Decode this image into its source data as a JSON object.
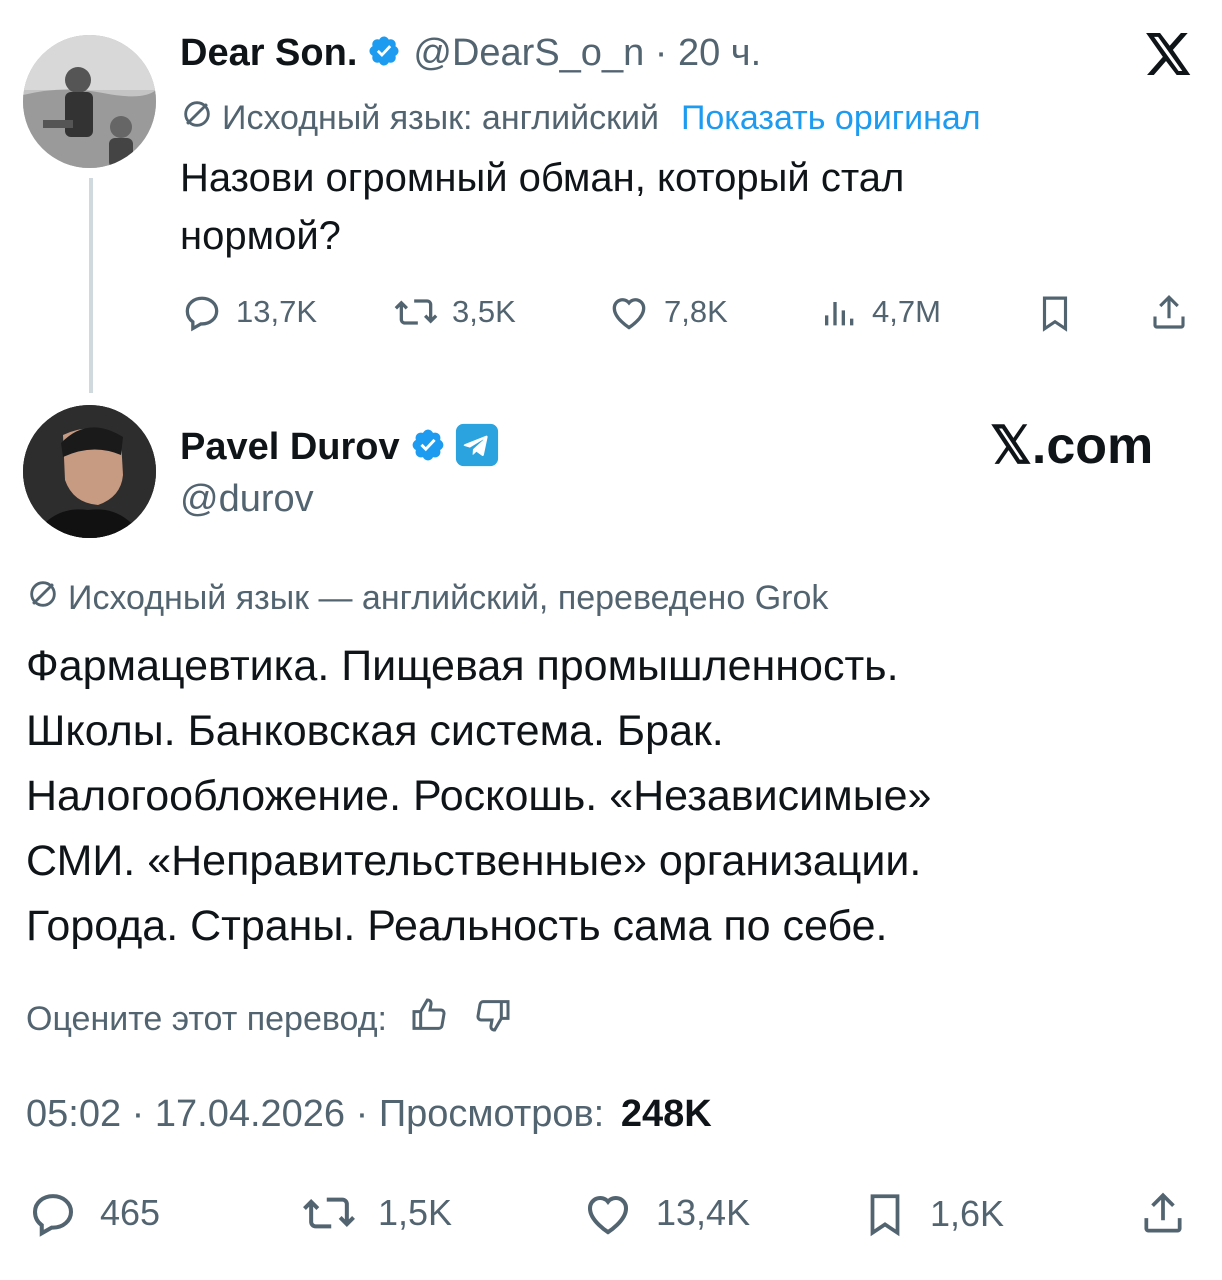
{
  "colors": {
    "accent": "#1d9bf0",
    "muted": "#536471",
    "text": "#0f1419",
    "line": "#cfd9de"
  },
  "quoted_tweet": {
    "author_name": "Dear Son.",
    "handle_time": "@DearS_o_n · 20 ч.",
    "translate_note": "Исходный язык: английский",
    "show_original": "Показать оригинал",
    "text_line1": "Назови огромный обман, который стал",
    "text_line2": "нормой?",
    "metrics": {
      "replies": "13,7K",
      "reposts": "3,5K",
      "likes": "7,8K",
      "views": "4,7M"
    },
    "icons": [
      "x-logo-icon",
      "reply-icon",
      "repost-icon",
      "like-icon",
      "views-icon",
      "bookmark-icon",
      "share-icon"
    ]
  },
  "main_tweet": {
    "author_name": "Pavel Durov",
    "handle": "@durov",
    "site_watermark": "𝕏.com",
    "translate_note": "Исходный язык — английский, переведено Grok",
    "text_lines": [
      "Фармацевтика. Пищевая промышленность.",
      "Школы. Банковская система. Брак.",
      "Налогообложение. Роскошь. «Независимые»",
      "СМИ. «Неправительственные» организации.",
      "Города. Страны. Реальность сама по себе."
    ],
    "rate_translation": "Оцените этот перевод:",
    "timestamp": "05:02 · 17.04.2026 · Просмотров:",
    "views": "248K",
    "metrics": {
      "replies": "465",
      "reposts": "1,5K",
      "likes": "13,4K",
      "bookmarks": "1,6K"
    },
    "icons": [
      "verified-badge-icon",
      "telegram-icon",
      "thumbs-up-icon",
      "thumbs-down-icon",
      "reply-icon",
      "repost-icon",
      "like-icon",
      "bookmark-icon",
      "share-icon"
    ]
  }
}
